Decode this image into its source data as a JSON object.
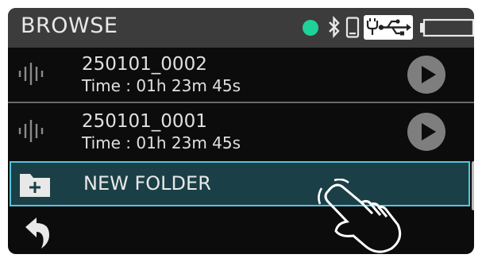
{
  "header": {
    "title": "BROWSE",
    "status_color": "#1fd29a",
    "icons": [
      "bluetooth-icon",
      "phone-icon",
      "usb-icon",
      "battery-icon"
    ]
  },
  "files": [
    {
      "name": "250101_0002",
      "time": "Time : 01h 23m 45s"
    },
    {
      "name": "250101_0001",
      "time": "Time : 01h 23m 45s"
    }
  ],
  "folder": {
    "label": "NEW FOLDER",
    "selected": true,
    "highlight_color": "#56c4da"
  },
  "footer": {
    "back_icon": "back-arrow-icon"
  }
}
